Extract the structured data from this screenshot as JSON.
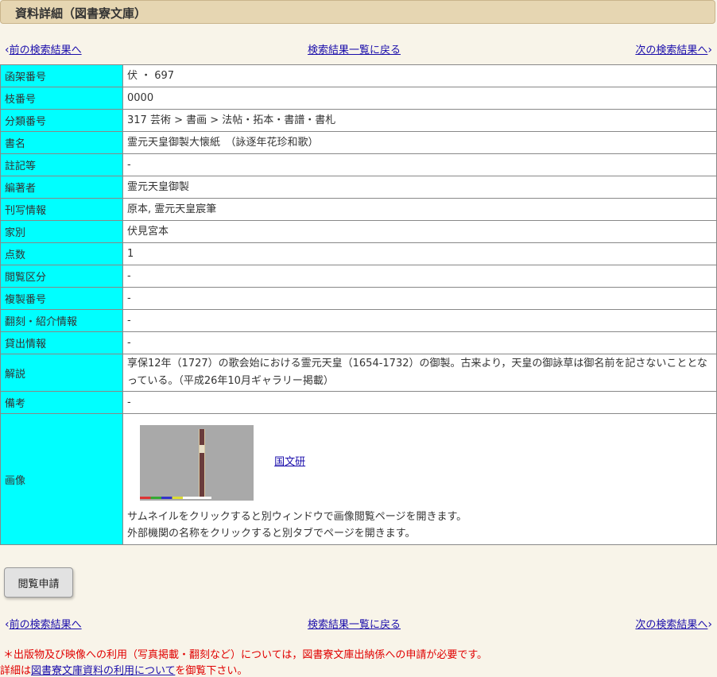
{
  "header": {
    "title": "資料詳細（図書寮文庫）"
  },
  "nav": {
    "prev": "前の検索結果へ",
    "list": "検索結果一覧に戻る",
    "next": "次の検索結果へ",
    "prev_chev": "‹",
    "next_chev": "›"
  },
  "rows": [
    {
      "label": "函架番号",
      "value": "伏 ・ 697"
    },
    {
      "label": "枝番号",
      "value": "0000"
    },
    {
      "label": "分類番号",
      "value": "317 芸術 > 書画 > 法帖・拓本・書譜・書札"
    },
    {
      "label": "書名",
      "value": "霊元天皇御製大懐紙　（詠逐年花珍和歌）"
    },
    {
      "label": "註記等",
      "value": "-"
    },
    {
      "label": "編著者",
      "value": "霊元天皇御製"
    },
    {
      "label": "刊写情報",
      "value": "原本, 霊元天皇宸筆"
    },
    {
      "label": "家別",
      "value": "伏見宮本"
    },
    {
      "label": "点数",
      "value": "1"
    },
    {
      "label": "閲覧区分",
      "value": "-"
    },
    {
      "label": "複製番号",
      "value": "-"
    },
    {
      "label": "翻刻・紹介情報",
      "value": "-"
    },
    {
      "label": "貸出情報",
      "value": "-"
    },
    {
      "label": "解説",
      "value": "享保12年（1727）の歌会始における霊元天皇（1654-1732）の御製。古来より，天皇の御詠草は御名前を記さないこととなっている。（平成26年10月ギャラリー掲載）"
    },
    {
      "label": "備考",
      "value": "-"
    }
  ],
  "image_row": {
    "label": "画像",
    "link": "国文研",
    "note1": "サムネイルをクリックすると別ウィンドウで画像閲覧ページを開きます。",
    "note2": "外部機関の名称をクリックすると別タブでページを開きます。"
  },
  "button": {
    "label": "閲覧申請"
  },
  "footer": {
    "line1": "＊出版物及び映像への利用（写真掲載・翻刻など）については，図書寮文庫出納係への申請が必要です。",
    "line2_pre": "詳細は",
    "line2_link": "図書寮文庫資料の利用について",
    "line2_post": "を御覧下さい。"
  }
}
